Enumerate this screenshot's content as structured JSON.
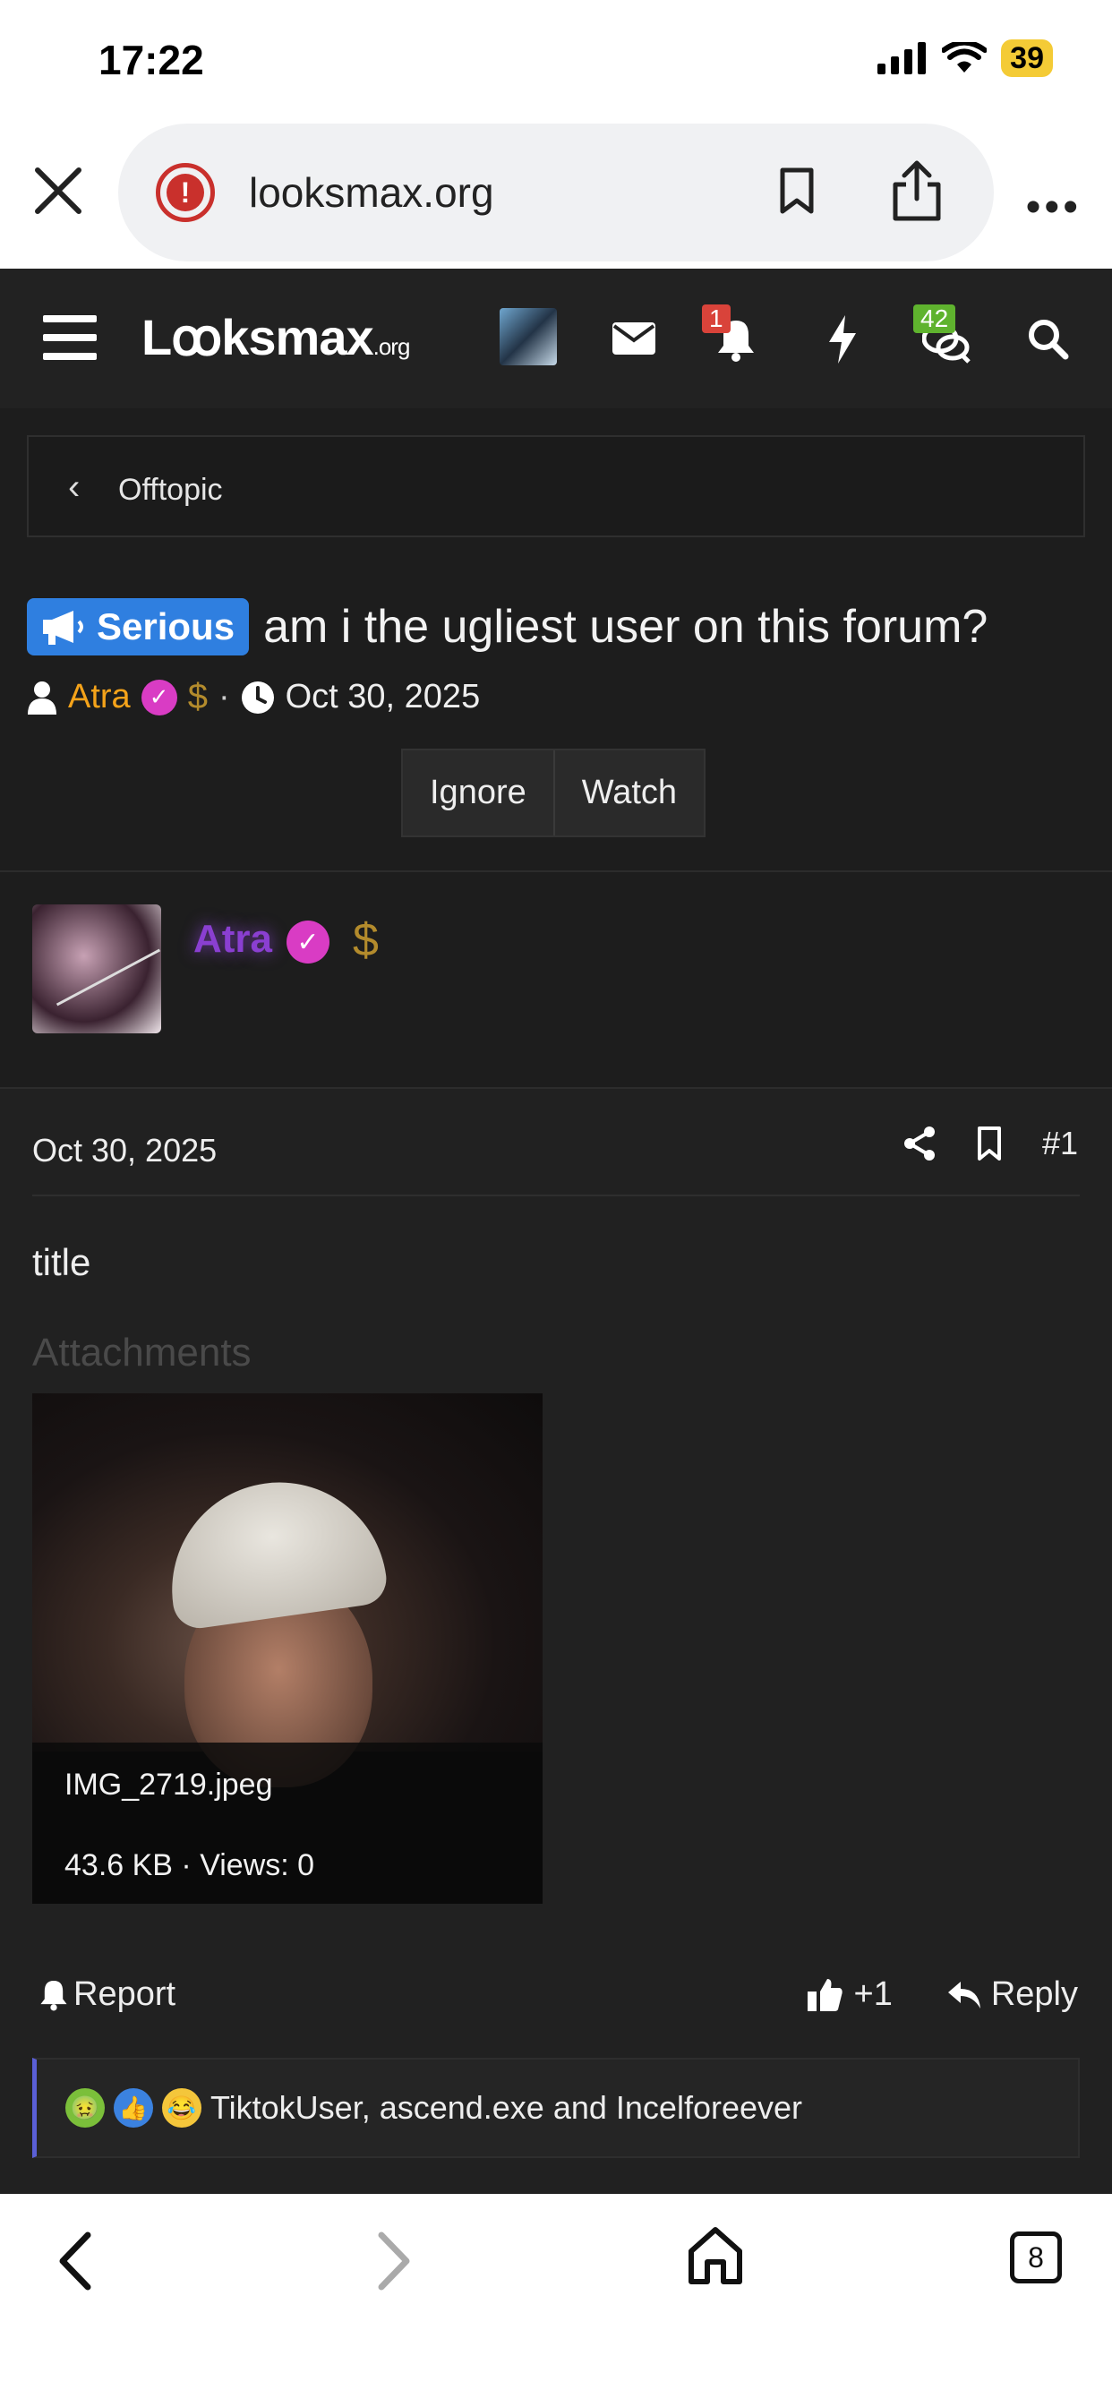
{
  "status": {
    "time": "17:22",
    "battery": "39"
  },
  "browser": {
    "url": "looksmax.org",
    "tab_count": "8"
  },
  "site": {
    "logo_main": "Lꝏksmax",
    "logo_suffix": ".org",
    "notification_badge": "1",
    "conversation_badge": "42"
  },
  "breadcrumb": {
    "label": "Offtopic"
  },
  "thread": {
    "prefix": "Serious",
    "title": "am i the ugliest user on this forum?",
    "author": "Atra",
    "date": "Oct 30, 2025",
    "ignore_label": "Ignore",
    "watch_label": "Watch"
  },
  "post": {
    "author": "Atra",
    "date": "Oct 30, 2025",
    "number": "#1",
    "text": "title",
    "attachments_label": "Attachments",
    "attachment": {
      "filename": "IMG_2719.jpeg",
      "meta": "43.6 KB · Views: 0"
    },
    "report_label": "Report",
    "like_label": "+1",
    "reply_label": "Reply",
    "reactions_text": "TiktokUser, ascend.exe and Incelforeever"
  },
  "colors": {
    "prefix_bg": "#2f7fe0",
    "author_orange": "#f5a31a",
    "verify_pink": "#d93cc4",
    "poster_name": "#8a3fd1"
  }
}
